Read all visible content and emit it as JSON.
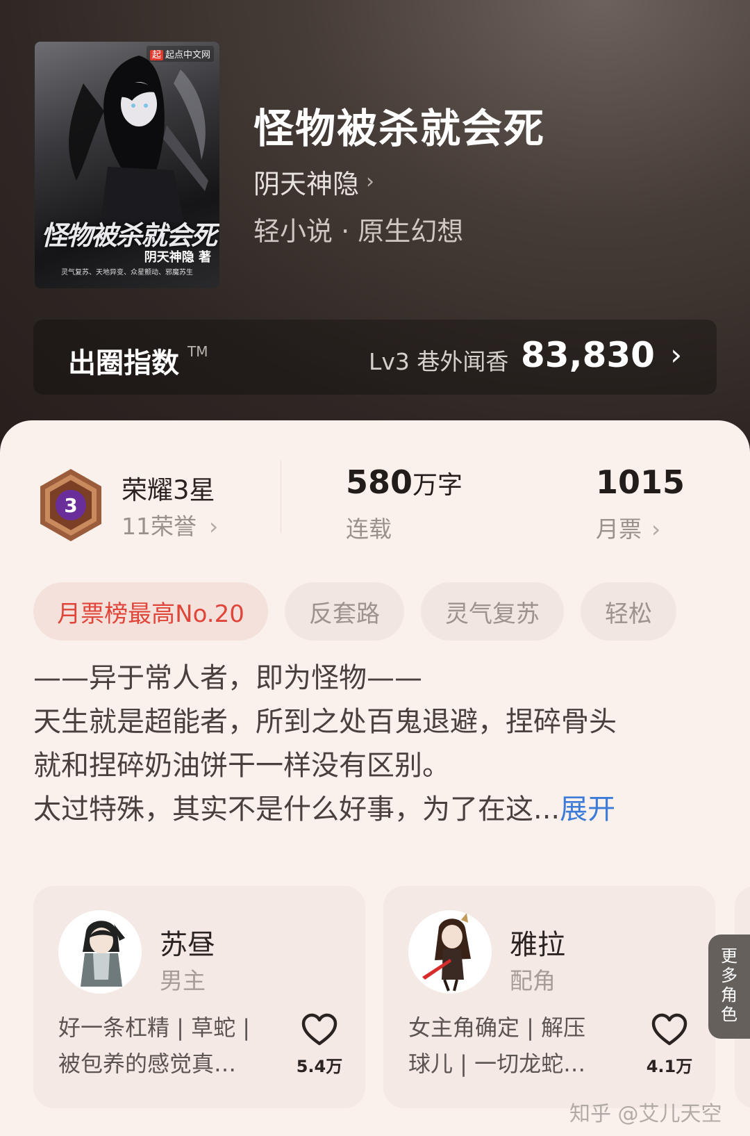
{
  "book": {
    "cover": {
      "badge_logo": "起",
      "badge_text": "起点中文网",
      "title": "怪物被杀就会死",
      "author": "阴天神隐 著",
      "tagline": "灵气复苏、天地异变、众星颤动、邪魔苏生"
    },
    "title": "怪物被杀就会死",
    "author": "阴天神隐",
    "category": "轻小说 · 原生幻想"
  },
  "influence": {
    "label": "出圈指数",
    "tm": "TM",
    "level": "Lv3 巷外闻香",
    "value": "83,830"
  },
  "stats": {
    "honor_badge_number": "3",
    "honor_title": "荣耀3星",
    "honor_count": "11荣誉",
    "words_number": "580",
    "words_unit": "万字",
    "words_status": "连载",
    "votes_number": "1015",
    "votes_label": "月票"
  },
  "tags": [
    "月票榜最高No.20",
    "反套路",
    "灵气复苏",
    "轻松"
  ],
  "description": {
    "lines": [
      "——异于常人者，即为怪物——",
      "天生就是超能者，所到之处百鬼退避，捏碎骨头",
      "就和捏碎奶油饼干一样没有区别。",
      "太过特殊，其实不是什么好事，为了在这..."
    ],
    "expand_label": "展开"
  },
  "characters": [
    {
      "name": "苏昼",
      "role": "男主",
      "desc_lines": [
        "好一条杠精 | 草蛇 |",
        "被包养的感觉真…"
      ],
      "likes": "5.4万"
    },
    {
      "name": "雅拉",
      "role": "配角",
      "desc_lines": [
        "女主角确定 | 解压",
        "球儿 | 一切龙蛇…"
      ],
      "likes": "4.1万"
    }
  ],
  "more_roles_chars": [
    "更",
    "多",
    "角",
    "色"
  ],
  "watermark": "知乎 @艾儿天空",
  "colors": {
    "accent_link": "#3d7bd8",
    "hot_tag": "#e0453a",
    "sheet_bg": "#faf1ec",
    "honor_purple": "#6a2e9a"
  },
  "icons": [
    "chevron-right-icon",
    "heart-icon",
    "honor-badge-icon"
  ]
}
